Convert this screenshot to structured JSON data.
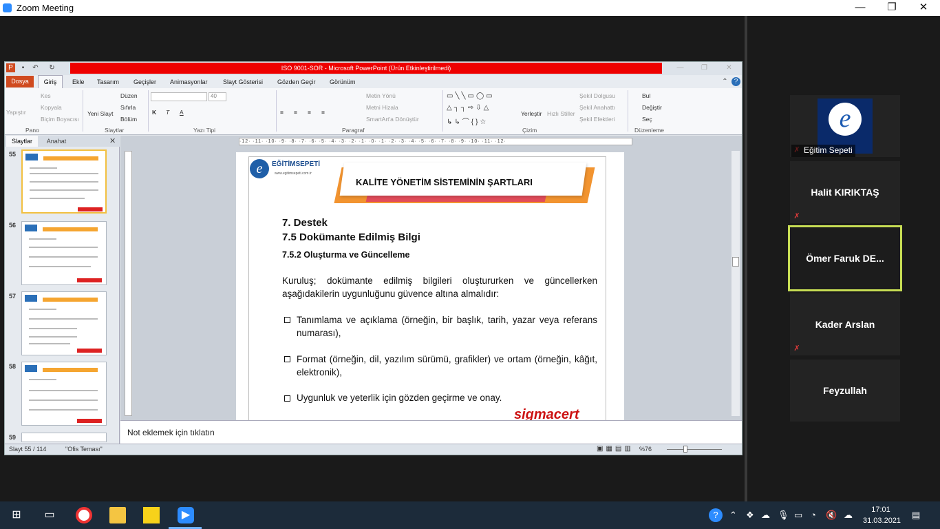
{
  "window": {
    "title": "Zoom Meeting",
    "minimize": "—",
    "maximize": "❐",
    "close": "✕"
  },
  "powerpoint": {
    "title": "ISO 9001-SOR  -  Microsoft PowerPoint (Ürün Etkinleştirilmedi)",
    "tabs": [
      "Dosya",
      "Giriş",
      "Ekle",
      "Tasarım",
      "Geçişler",
      "Animasyonlar",
      "Slayt Gösterisi",
      "Gözden Geçir",
      "Görünüm"
    ],
    "ribbon": {
      "pano": {
        "paste": "Yapıştır",
        "cut": "Kes",
        "copy": "Kopyala",
        "format_painter": "Biçim Boyacısı",
        "group": "Pano"
      },
      "slaytlar": {
        "new_slide": "Yeni Slayt",
        "layout": "Düzen",
        "reset": "Sıfırla",
        "section": "Bölüm",
        "group": "Slaytlar"
      },
      "yazi_tipi": {
        "font_size": "40",
        "group": "Yazı Tipi"
      },
      "paragraf": {
        "text_direction": "Metin Yönü",
        "align_text": "Metni Hizala",
        "smartart": "SmartArt'a Dönüştür",
        "group": "Paragraf"
      },
      "cizim": {
        "arrange": "Yerleştir",
        "quick_styles": "Hızlı Stiller",
        "shape_fill": "Şekil Dolgusu",
        "shape_outline": "Şekil Anahattı",
        "shape_effects": "Şekil Efektleri",
        "group": "Çizim"
      },
      "duzenleme": {
        "find": "Bul",
        "replace": "Değiştir",
        "select": "Seç",
        "group": "Düzenleme"
      }
    },
    "pane_tabs": [
      "Slaytlar",
      "Anahat"
    ],
    "thumbnails": [
      {
        "num": "55",
        "heading": "KALİTE YÖNETİM SİSTEMİNİN ŞARTLARI"
      },
      {
        "num": "56",
        "heading": "KALİTE YÖNETİM SİSTEMİNİN ŞARTLARI"
      },
      {
        "num": "57",
        "heading": "KALİTE YÖNETİM SİSTEMİNİN ŞARTLARI"
      },
      {
        "num": "58",
        "heading": "KALİTE YÖNETİM SİSTEMİNİN ŞARTLARI"
      },
      {
        "num": "59",
        "heading": ""
      }
    ],
    "ruler": "·12· ·11· ·10· ·9· ·8· ·7· ·6· ·5· ·4· ·3· ·2· ·1· ·0· ·1· ·2· ·3· ·4· ·5· ·6· ·7· ·8· ·9· ·10· ·11· ·12·",
    "slide": {
      "logo_text": "EĞİTİMSEPETİ",
      "logo_sub": "www.egitimsepeti.com.tr",
      "banner": "KALİTE YÖNETİM SİSTEMİNİN ŞARTLARI",
      "h1": "7. Destek",
      "h2": "7.5 Dokümante Edilmiş Bilgi",
      "h3": "7.5.2 Oluşturma  ve Güncelleme",
      "intro": "Kuruluş; dokümante edilmiş bilgileri oluştururken ve güncellerken aşağıdakilerin uygunluğunu güvence altına almalıdır:",
      "bullets": [
        "Tanımlama ve açıklama (örneğin, bir başlık, tarih, yazar veya referans numarası),",
        "Format (örneğin, dil, yazılım sürümü, grafikler) ve ortam (örneğin, kâğıt, elektronik),",
        "Uygunluk ve yeterlik için gözden geçirme ve onay."
      ],
      "footer_logo": "sigmacert"
    },
    "notes_placeholder": "Not eklemek için tıklatın",
    "status": {
      "slide": "Slayt 55 / 114",
      "theme": "\"Ofis Teması\"",
      "zoom": "%76"
    }
  },
  "participants": [
    {
      "name": "Eğitim Sepeti",
      "muted": true,
      "video": true
    },
    {
      "name": "Halit KIRIKTAŞ",
      "muted": true
    },
    {
      "name": "Ömer  Faruk DE...",
      "muted": false,
      "active": true
    },
    {
      "name": "Kader Arslan",
      "muted": true
    },
    {
      "name": "Feyzullah",
      "muted": false
    }
  ],
  "taskbar": {
    "time": "17:01",
    "date": "31.03.2021"
  },
  "colors": {
    "zoom_blue": "#2d8cff",
    "active_speaker": "#c7dd54",
    "ppt_red_bar": "#ee0000",
    "dosya_tab": "#d04a1f",
    "mute_red": "#e03a3a"
  }
}
